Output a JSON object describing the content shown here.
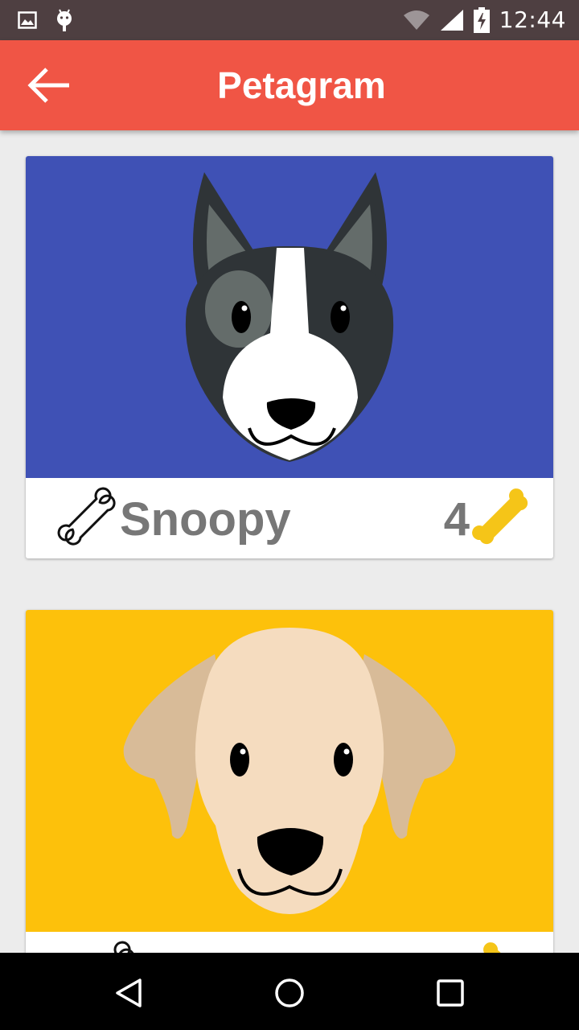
{
  "status_bar": {
    "time": "12:44",
    "icons": [
      "gallery-notification-icon",
      "android-notification-icon",
      "wifi-icon",
      "cell-signal-icon",
      "battery-charging-icon"
    ]
  },
  "app_bar": {
    "title": "Petagram",
    "back_icon": "arrow-back-icon"
  },
  "pets": [
    {
      "name": "Snoopy",
      "rating": "4",
      "background": "#3f51b5",
      "breed_icon": "dark-dog-face"
    },
    {
      "name": "",
      "rating": "",
      "background": "#fdc10b",
      "breed_icon": "labrador-dog-face"
    }
  ],
  "colors": {
    "primary": "#f05545",
    "status_bar": "#4e3f41",
    "bone_rated": "#f5c518",
    "text": "#777777"
  },
  "nav_bar": {
    "buttons": [
      "back-triangle-icon",
      "home-circle-icon",
      "recents-square-icon"
    ]
  }
}
